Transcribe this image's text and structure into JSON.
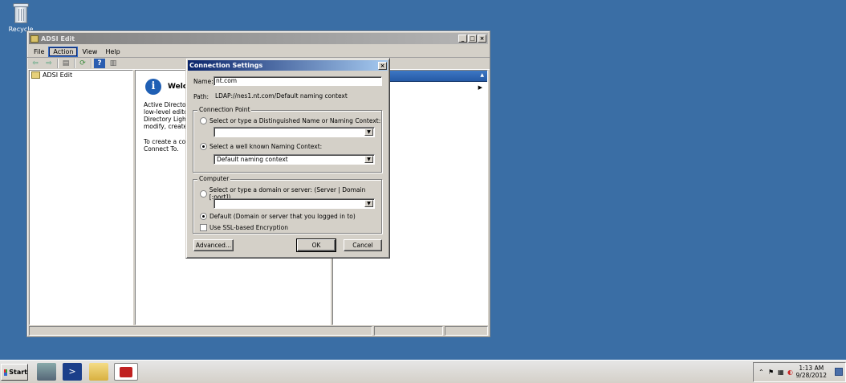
{
  "desktop": {
    "recycle_label": "Recycle"
  },
  "window": {
    "title": "ADSI Edit",
    "controls": [
      "_",
      "□",
      "×"
    ],
    "menu": [
      "File",
      "Action",
      "View",
      "Help"
    ],
    "tree_root": "ADSI Edit",
    "welcome_title": "Welco",
    "welcome_text": "Active Directory S\nlow-level editor f\nDirectory Lightwe\nmodify, create, a",
    "welcome_text2": "To create a conn\nConnect To."
  },
  "dialog": {
    "title": "Connection Settings",
    "close": "×",
    "name_label": "Name:",
    "name_value": "nt.com",
    "path_label": "Path:",
    "path_value": "LDAP://nes1.nt.com/Default naming context",
    "connection_point": {
      "label": "Connection Point",
      "option1": "Select or type a Distinguished Name or Naming Context:",
      "option1_value": "",
      "option2": "Select a well known Naming Context:",
      "option2_value": "Default naming context",
      "selected": "option2"
    },
    "computer": {
      "label": "Computer",
      "option1": "Select or type a domain or server: (Server | Domain [:port])",
      "option1_value": "",
      "option2": "Default (Domain or server that you logged in to)",
      "selected": "option2",
      "ssl_label": "Use SSL-based Encryption",
      "ssl_checked": false
    },
    "advanced_button": "Advanced...",
    "ok_button": "OK",
    "cancel_button": "Cancel"
  },
  "taskbar": {
    "start_label": "Start",
    "clock_time": "1:13 AM",
    "clock_date": "9/28/2012"
  }
}
